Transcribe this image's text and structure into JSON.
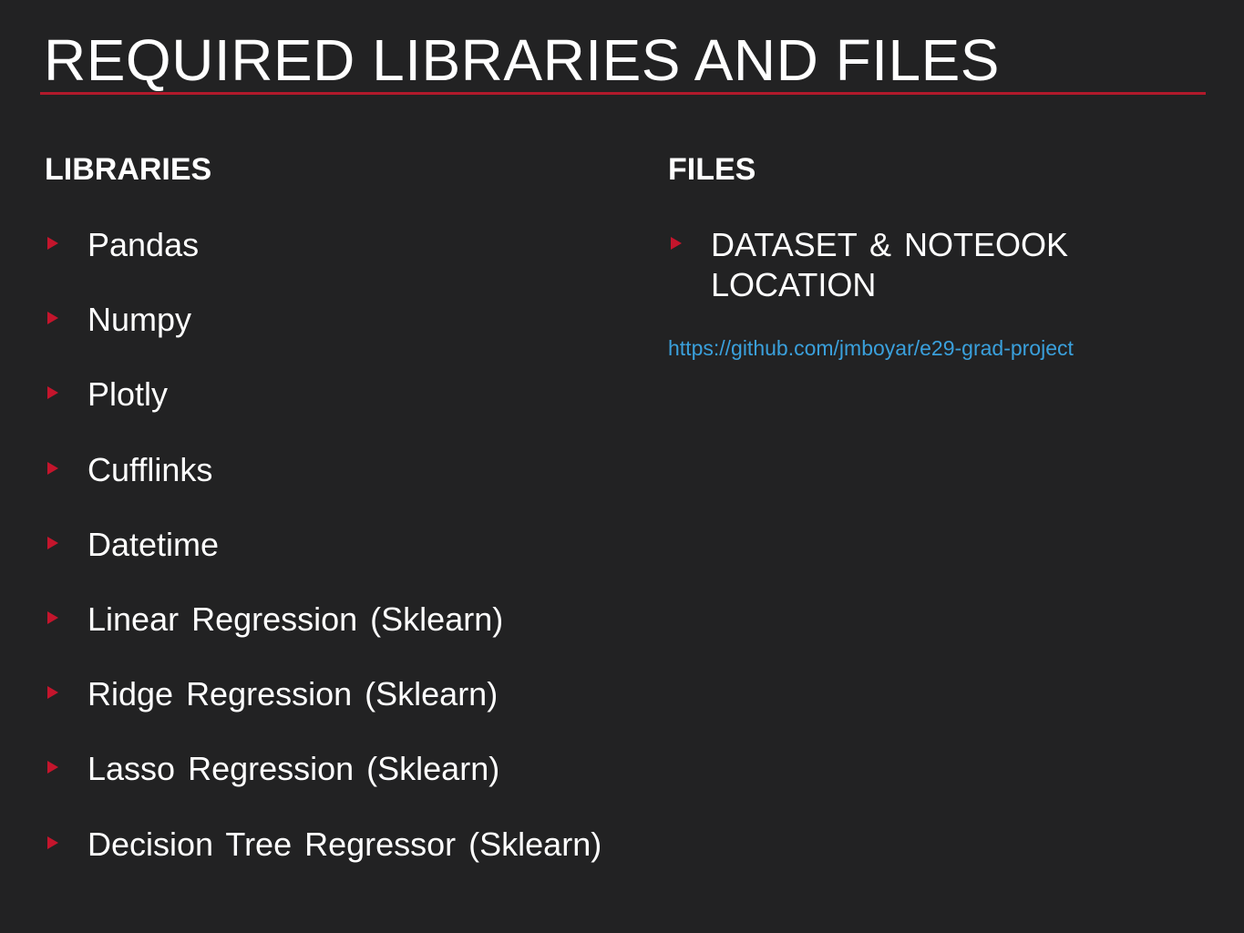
{
  "slide": {
    "title": "REQUIRED LIBRARIES AND FILES"
  },
  "libraries": {
    "heading": "LIBRARIES",
    "items": [
      "Pandas",
      "Numpy",
      "Plotly",
      "Cufflinks",
      "Datetime",
      "Linear Regression (Sklearn)",
      "Ridge Regression (Sklearn)",
      "Lasso Regression (Sklearn)",
      "Decision Tree Regressor (Sklearn)"
    ]
  },
  "files": {
    "heading": "FILES",
    "items": [
      "DATASET & NOTEOOK LOCATION"
    ],
    "link": "https://github.com/jmboyar/e29-grad-project"
  },
  "colors": {
    "background": "#222223",
    "accent": "#b11a2b",
    "bullet": "#c4152c",
    "text": "#ffffff",
    "link": "#3aa0dc"
  },
  "icons": {
    "bullet": "triangle-bullet-icon"
  }
}
